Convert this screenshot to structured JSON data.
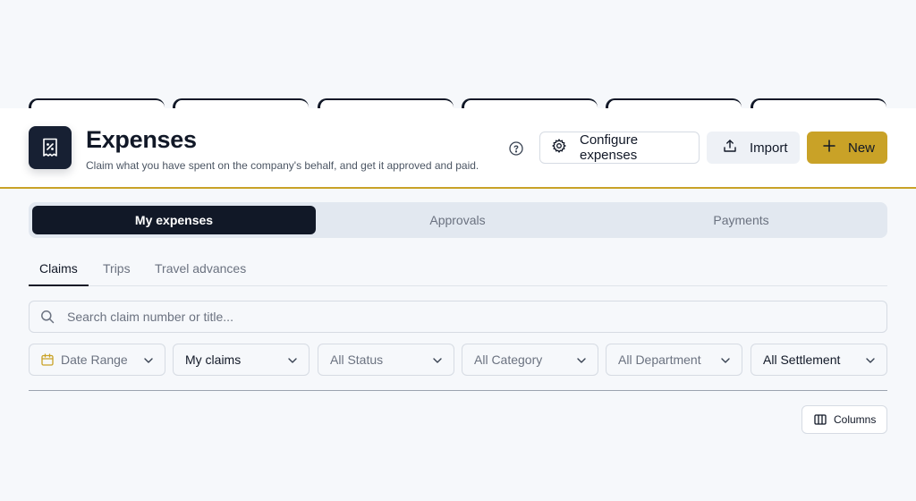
{
  "header": {
    "title": "Expenses",
    "subtitle": "Claim what you have spent on the company's behalf, and get it approved and paid.",
    "configure_label": "Configure expenses",
    "import_label": "Import",
    "new_label": "New",
    "accent_color": "#c9a227"
  },
  "segments": [
    "My expenses",
    "Approvals",
    "Payments"
  ],
  "subtabs": [
    "Claims",
    "Trips",
    "Travel advances"
  ],
  "search": {
    "placeholder": "Search claim number or title..."
  },
  "filters": {
    "date_range": "Date Range",
    "claims_scope": "My claims",
    "status": "All Status",
    "category": "All Category",
    "department": "All Department",
    "settlement": "All Settlement"
  },
  "table": {
    "columns_label": "Columns"
  }
}
